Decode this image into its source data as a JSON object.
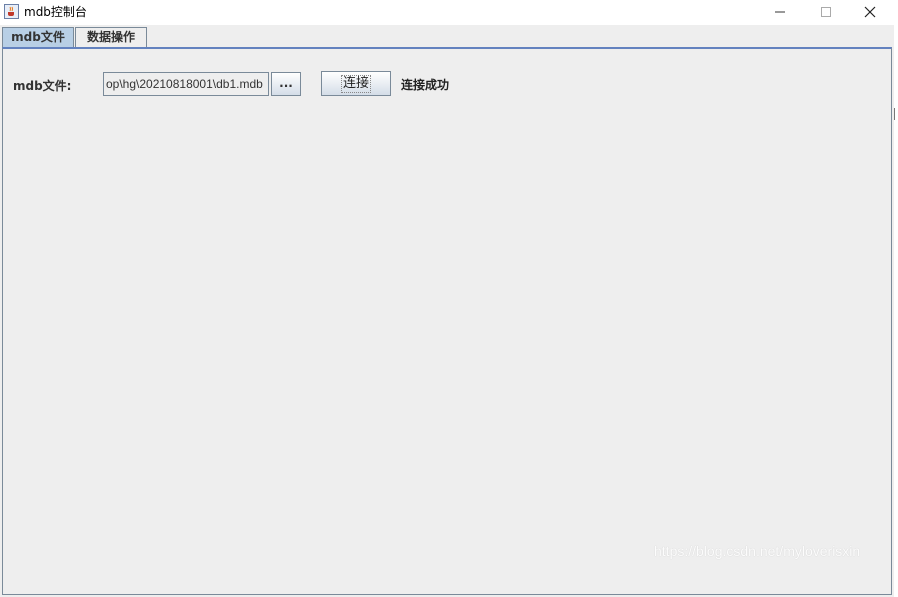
{
  "window": {
    "title": "mdb控制台",
    "icon": "java-cup-icon"
  },
  "tabs": [
    {
      "label": "mdb文件",
      "selected": true
    },
    {
      "label": "数据操作",
      "selected": false
    }
  ],
  "form": {
    "file_label": "mdb文件:",
    "file_path": "op\\hg\\20210818001\\db1.mdb",
    "browse_label": "...",
    "connect_label": "连接",
    "status": "连接成功"
  },
  "watermark": "https://blog.csdn.net/myloverisxin",
  "colors": {
    "selected_tab": "#b8cfe5",
    "panel_border": "#6382bf",
    "background": "#eeeeee"
  }
}
